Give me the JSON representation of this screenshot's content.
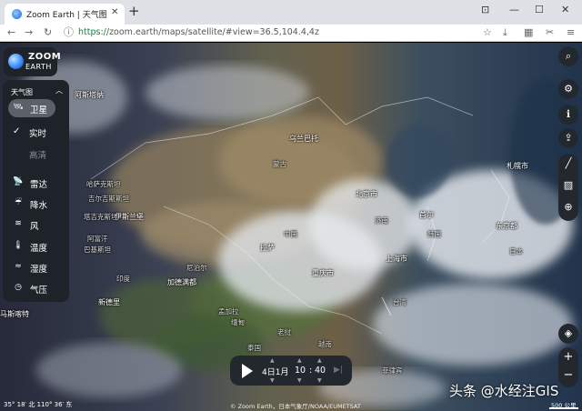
{
  "browser": {
    "tab_title": "Zoom Earth | 天气图、台风",
    "tab_close": "✕",
    "new_tab": "+",
    "url_scheme": "https://",
    "url_rest": "zoom.earth/maps/satellite/#view=36.5,104.4,4z"
  },
  "app": {
    "logo_line1": "ZOOM",
    "logo_line2": "EARTH",
    "panel_title": "天气图",
    "layers": [
      {
        "label": "卫星",
        "icon": "satellite-icon",
        "active": true
      },
      {
        "label": "雷达",
        "icon": "radar-icon"
      },
      {
        "label": "降水",
        "icon": "precipitation-icon"
      },
      {
        "label": "风",
        "icon": "wind-icon"
      },
      {
        "label": "温度",
        "icon": "temperature-icon"
      },
      {
        "label": "湿度",
        "icon": "humidity-icon"
      },
      {
        "label": "气压",
        "icon": "pressure-icon"
      }
    ],
    "satellite_options": [
      "实时",
      "高清"
    ]
  },
  "places": [
    "阿斯塔纳",
    "哈萨克斯坦",
    "乌兰巴托",
    "蒙古",
    "北京市",
    "韩国",
    "首尔",
    "日本",
    "东京都",
    "上海市",
    "台湾",
    "中国",
    "拉萨",
    "重庆市",
    "加德满都",
    "孟加拉",
    "印度",
    "尼泊尔",
    "缅甸",
    "老挝",
    "泰国",
    "越南",
    "菲律宾",
    "吉尔吉斯斯坦",
    "塔吉克斯坦",
    "阿富汗",
    "巴基斯坦",
    "伊斯兰堡",
    "新德里",
    "马斯喀特",
    "札幌市",
    "济南"
  ],
  "timebar": {
    "date": "4日1月",
    "hour": "10",
    "colon": ":",
    "minute": "40"
  },
  "status": {
    "coords": "35° 18′ 北  110° 36′ 东",
    "attribution": "© Zoom Earth，日本气象厅/NOAA/EUMETSAT",
    "scale": "500 公里"
  },
  "watermark": "头条 @水经注GIS"
}
